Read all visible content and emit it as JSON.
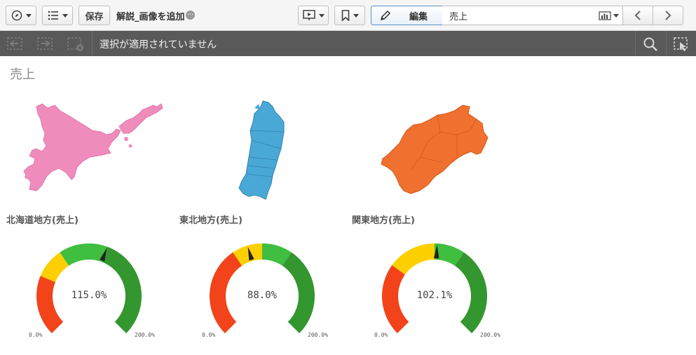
{
  "toolbar": {
    "save_label": "保存",
    "sheet_title": "解説_画像を追加",
    "edit_label": "編集",
    "sheet_selector_value": "売上"
  },
  "selection": {
    "status_text": "選択が適用されていません"
  },
  "sheet": {
    "title": "売上"
  },
  "colors": {
    "hokkaido_fill": "#f08cbc",
    "tohoku_fill": "#4aa8d6",
    "kanto_fill": "#f07030",
    "gauge_red": "#f2431b",
    "gauge_yellow": "#fcd000",
    "gauge_lightgreen": "#3fbe3f",
    "gauge_green": "#34962f"
  },
  "regions": [
    {
      "label": "北海道地方(売上)",
      "value_text": "115.0%",
      "value": 115.0,
      "min_label": "0.0%",
      "max_label": "200.0%"
    },
    {
      "label": "東北地方(売上)",
      "value_text": "88.0%",
      "value": 88.0,
      "min_label": "0.0%",
      "max_label": "200.0%"
    },
    {
      "label": "関東地方(売上)",
      "value_text": "102.1%",
      "value": 102.1,
      "min_label": "0.0%",
      "max_label": "200.0%"
    }
  ],
  "chart_data": [
    {
      "type": "gauge",
      "title": "北海道地方(売上)",
      "value": 115.0,
      "min": 0,
      "max": 200,
      "bands": [
        {
          "from": 0,
          "to": 50,
          "color": "#f2431b"
        },
        {
          "from": 50,
          "to": 75,
          "color": "#fcd000"
        },
        {
          "from": 75,
          "to": 115,
          "color": "#3fbe3f"
        },
        {
          "from": 115,
          "to": 200,
          "color": "#34962f"
        }
      ]
    },
    {
      "type": "gauge",
      "title": "東北地方(売上)",
      "value": 88.0,
      "min": 0,
      "max": 200,
      "bands": [
        {
          "from": 0,
          "to": 75,
          "color": "#f2431b"
        },
        {
          "from": 75,
          "to": 100,
          "color": "#fcd000"
        },
        {
          "from": 100,
          "to": 125,
          "color": "#3fbe3f"
        },
        {
          "from": 125,
          "to": 200,
          "color": "#34962f"
        }
      ]
    },
    {
      "type": "gauge",
      "title": "関東地方(売上)",
      "value": 102.1,
      "min": 0,
      "max": 200,
      "bands": [
        {
          "from": 0,
          "to": 60,
          "color": "#f2431b"
        },
        {
          "from": 60,
          "to": 100,
          "color": "#fcd000"
        },
        {
          "from": 100,
          "to": 125,
          "color": "#3fbe3f"
        },
        {
          "from": 125,
          "to": 200,
          "color": "#34962f"
        }
      ]
    }
  ]
}
